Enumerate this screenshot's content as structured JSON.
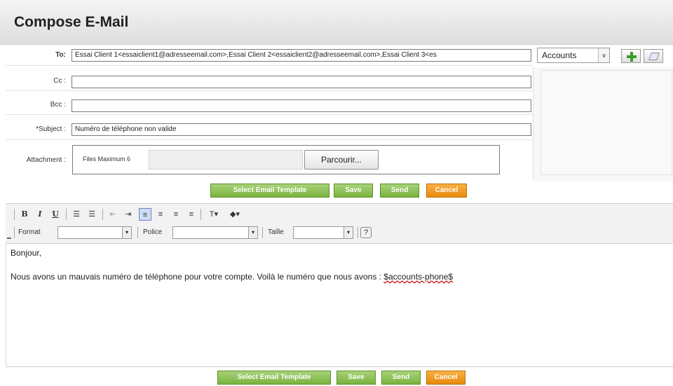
{
  "header": {
    "title": "Compose E-Mail"
  },
  "form": {
    "to_label": "To:",
    "to_value": "Essai Client 1<essaiclient1@adresseemail.com>,Essai Client 2<essaiclient2@adresseemail.com>,Essai Client 3<es",
    "cc_label": "Cc :",
    "cc_value": "",
    "bcc_label": "Bcc :",
    "bcc_value": "",
    "subject_label": "*Subject :",
    "subject_value": "Numéro de téléphone non valide",
    "attachment_label": "Attachment :",
    "attachment_hint": "Files Maximum 6",
    "browse_label": "Parcourir..."
  },
  "related": {
    "select_value": "Accounts",
    "select_arrow": "v",
    "add_icon": "plus-icon",
    "clear_icon": "eraser-icon"
  },
  "buttons": {
    "template": "Select Email Template",
    "save": "Save",
    "send": "Send",
    "cancel": "Cancel"
  },
  "toolbar": {
    "bold": "B",
    "italic": "I",
    "underline": "U",
    "format_label": "Format",
    "font_label": "Police",
    "size_label": "Taille",
    "help": "?"
  },
  "body": {
    "line1": "Bonjour,",
    "line2_text": "Nous avons un mauvais numéro de téléphone pour votre compte. Voilà le numéro que nous avons : ",
    "line2_var": "$accounts-phone$"
  },
  "colors": {
    "green_button": "#7ab33f",
    "orange_button": "#e88a0c",
    "active_tool": "#cfdcf6"
  }
}
